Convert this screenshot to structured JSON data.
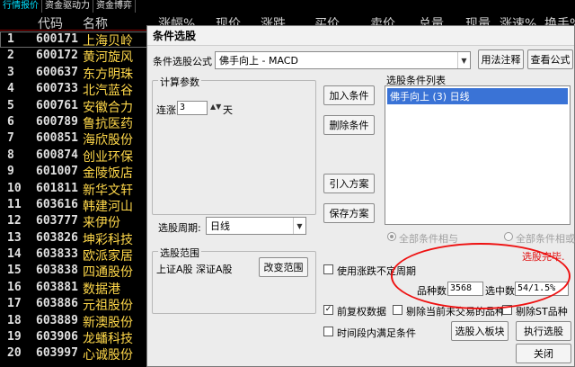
{
  "top_tabs": [
    "行情报价",
    "资金驱动力",
    "资金博弈"
  ],
  "columns": [
    "代码",
    "名称",
    "涨幅%",
    "现价",
    "涨跌",
    "买价",
    "卖价",
    "总量",
    "现量",
    "涨速%",
    "换手%"
  ],
  "stocks": [
    {
      "num": "1",
      "code": "600171",
      "name": "上海贝岭"
    },
    {
      "num": "2",
      "code": "600172",
      "name": "黄河旋风"
    },
    {
      "num": "3",
      "code": "600637",
      "name": "东方明珠"
    },
    {
      "num": "4",
      "code": "600733",
      "name": "北汽蓝谷"
    },
    {
      "num": "5",
      "code": "600761",
      "name": "安徽合力"
    },
    {
      "num": "6",
      "code": "600789",
      "name": "鲁抗医药"
    },
    {
      "num": "7",
      "code": "600851",
      "name": "海欣股份"
    },
    {
      "num": "8",
      "code": "600874",
      "name": "创业环保"
    },
    {
      "num": "9",
      "code": "601007",
      "name": "金陵饭店"
    },
    {
      "num": "10",
      "code": "601811",
      "name": "新华文轩"
    },
    {
      "num": "11",
      "code": "603616",
      "name": "韩建河山"
    },
    {
      "num": "12",
      "code": "603777",
      "name": "来伊份"
    },
    {
      "num": "13",
      "code": "603826",
      "name": "坤彩科技"
    },
    {
      "num": "14",
      "code": "603833",
      "name": "欧派家居"
    },
    {
      "num": "15",
      "code": "603838",
      "name": "四通股份"
    },
    {
      "num": "16",
      "code": "603881",
      "name": "数据港"
    },
    {
      "num": "17",
      "code": "603886",
      "name": "元祖股份"
    },
    {
      "num": "18",
      "code": "603889",
      "name": "新澳股份"
    },
    {
      "num": "19",
      "code": "603906",
      "name": "龙蟠科技"
    },
    {
      "num": "20",
      "code": "603997",
      "name": "心诚股份"
    }
  ],
  "dialog": {
    "title": "条件选股",
    "formula_label": "条件选股公式",
    "formula_value": "佛手向上      - MACD",
    "btn_usage": "用法注释",
    "btn_view": "查看公式",
    "params_title": "计算参数",
    "param_label": "连涨",
    "param_value": "3",
    "param_unit": "天",
    "btn_add": "加入条件",
    "btn_delete": "删除条件",
    "btn_import": "引入方案",
    "btn_save": "保存方案",
    "list_title": "选股条件列表",
    "list_items": [
      "佛手向上 (3) 日线"
    ],
    "period_label": "选股周期:",
    "period_value": "日线",
    "radio_and": "全部条件相与",
    "radio_or": "全部条件相或",
    "done_text": "选股完毕.",
    "range_title": "选股范围",
    "range_value": "上证A股 深证A股",
    "btn_change_range": "改变范围",
    "chk_variable": "使用涨跌不定周期",
    "count_label": "品种数",
    "count_value": "3568",
    "selected_label": "选中数",
    "selected_value": "54/1.5%",
    "chk_adjust": "前复权数据",
    "chk_exclude_halt": "剔除当前未交易的品种",
    "chk_exclude_st": "剔除ST品种",
    "chk_time": "时间段内满足条件",
    "btn_to_block": "选股入板块",
    "btn_execute": "执行选股",
    "btn_close": "关闭"
  },
  "colors": {
    "stock_name": "#ffd84a",
    "highlight": "#3a73d6",
    "annotation": "#e11111"
  }
}
